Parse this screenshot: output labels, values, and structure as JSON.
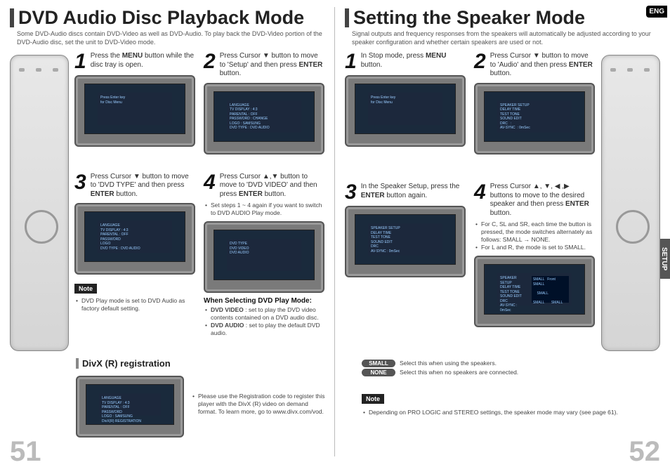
{
  "lang_badge": "ENG",
  "setup_tab": "SETUP",
  "left": {
    "title": "DVD Audio Disc Playback Mode",
    "subtitle": "Some DVD-Audio discs contain DVD-Video as well as DVD-Audio.\nTo play back the DVD-Video portion of the DVD-Audio disc, set the unit to DVD-Video mode.",
    "steps": [
      {
        "n": "1",
        "text": "Press the <b>MENU</b> button while the disc tray is open."
      },
      {
        "n": "2",
        "text": "Press Cursor <span class='arrow'>▼</span> button to move to 'Setup' and then press <b>ENTER</b> button."
      },
      {
        "n": "3",
        "text": "Press Cursor <span class='arrow'>▼</span> button to move to 'DVD TYPE' and then press <b>ENTER</b> button."
      },
      {
        "n": "4",
        "text": "Press Cursor <span class='arrow'>▲</span>,<span class='arrow'>▼</span> button to move to 'DVD VIDEO' and then press <b>ENTER</b> button."
      }
    ],
    "step4_bullet": "Set steps 1 ~ 4 again if you want to switch to DVD AUDIO Play mode.",
    "when_selecting_head": "When Selecting DVD Play Mode:",
    "when_selecting": [
      "<b>DVD VIDEO</b> : set to play the DVD video contents contained on a DVD audio disc.",
      "<b>DVD AUDIO</b> : set to play the default DVD audio."
    ],
    "note_label": "Note",
    "note_text": "DVD Play mode is set to DVD Audio as factory default setting.",
    "divx_title": "DivX (R) registration",
    "divx_text": "Please use the Registration code to register this player with the DivX (R) video on demand format. To learn more, go to www.divx.com/vod.",
    "page_num": "51"
  },
  "right": {
    "title": "Setting the Speaker Mode",
    "subtitle": "Signal outputs and frequency responses from the speakers will automatically be adjusted according to your speaker configuration and whether certain speakers are used or not.",
    "steps": [
      {
        "n": "1",
        "text": "In Stop mode, press <b>MENU</b> button."
      },
      {
        "n": "2",
        "text": "Press Cursor <span class='arrow'>▼</span> button to move to 'Audio' and then press <b>ENTER</b> button."
      },
      {
        "n": "3",
        "text": "In the Speaker Setup, press the <b>ENTER</b> button again."
      },
      {
        "n": "4",
        "text": "Press Cursor <span class='arrow'>▲</span>, <span class='arrow'>▼</span>, <span class='arrow'>◀</span> ,<span class='arrow'>▶</span> buttons to move to the desired speaker and then press <b>ENTER</b> button."
      }
    ],
    "step4_bullets": [
      "For C, SL and SR, each time the button is pressed, the mode switches alternately as follows: SMALL → NONE.",
      "For L and R, the mode is set to SMALL."
    ],
    "pills": [
      {
        "label": "SMALL",
        "text": "Select this when using the speakers."
      },
      {
        "label": "NONE",
        "text": "Select this when no speakers are connected."
      }
    ],
    "note_label": "Note",
    "note_text": "Depending on PRO LOGIC and STEREO settings, the speaker mode may vary (see page 61).",
    "page_num": "52"
  }
}
